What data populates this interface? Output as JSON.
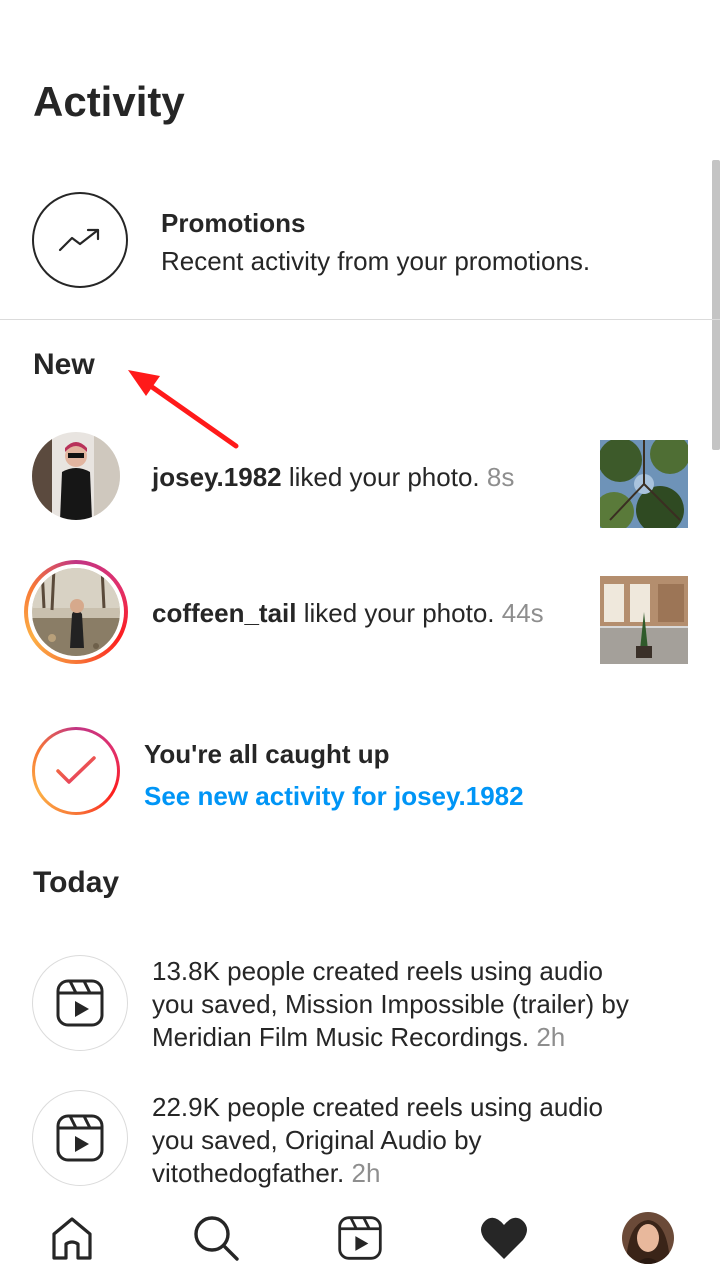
{
  "header": {
    "title": "Activity"
  },
  "promotions": {
    "icon": "trending-up-icon",
    "title": "Promotions",
    "subtitle": "Recent activity from your promotions."
  },
  "sections": {
    "new": "New",
    "today": "Today"
  },
  "new_items": [
    {
      "username": "josey.1982",
      "action": " liked your photo. ",
      "time": "8s",
      "has_story_ring": false
    },
    {
      "username": "coffeen_tail",
      "action": " liked your photo. ",
      "time": "44s",
      "has_story_ring": true
    }
  ],
  "caught_up": {
    "icon": "check-icon",
    "title": "You're all caught up",
    "link": "See new activity for josey.1982"
  },
  "today_items": [
    {
      "icon": "reels-icon",
      "text": "13.8K people created reels using audio you saved, Mission Impossible (trailer) by Meridian Film Music Recordings. ",
      "time": "2h"
    },
    {
      "icon": "reels-icon",
      "text": "22.9K people created reels using audio you saved, Original Audio by vitothedogfather. ",
      "time": "2h"
    }
  ],
  "bottom_nav": [
    "home-icon",
    "search-icon",
    "reels-icon",
    "heart-icon",
    "profile-avatar"
  ],
  "colors": {
    "text": "#262626",
    "secondary": "#8e8e8e",
    "link": "#0095f6",
    "annotation": "#ff0000"
  }
}
